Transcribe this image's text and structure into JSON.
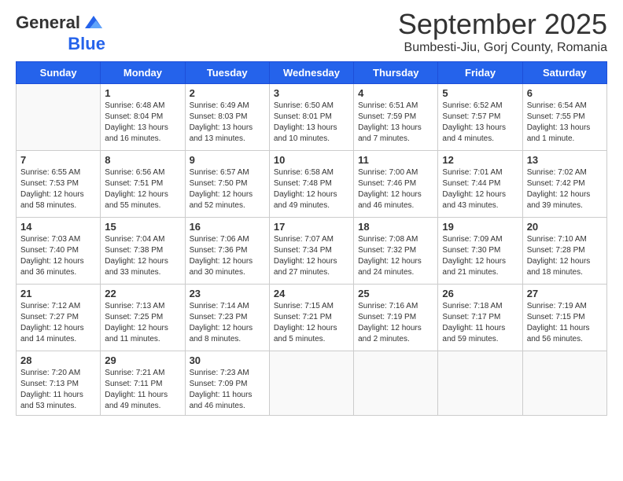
{
  "header": {
    "logo_general": "General",
    "logo_blue": "Blue",
    "month_title": "September 2025",
    "subtitle": "Bumbesti-Jiu, Gorj County, Romania"
  },
  "days_of_week": [
    "Sunday",
    "Monday",
    "Tuesday",
    "Wednesday",
    "Thursday",
    "Friday",
    "Saturday"
  ],
  "weeks": [
    [
      {
        "day": "",
        "info": ""
      },
      {
        "day": "1",
        "info": "Sunrise: 6:48 AM\nSunset: 8:04 PM\nDaylight: 13 hours\nand 16 minutes."
      },
      {
        "day": "2",
        "info": "Sunrise: 6:49 AM\nSunset: 8:03 PM\nDaylight: 13 hours\nand 13 minutes."
      },
      {
        "day": "3",
        "info": "Sunrise: 6:50 AM\nSunset: 8:01 PM\nDaylight: 13 hours\nand 10 minutes."
      },
      {
        "day": "4",
        "info": "Sunrise: 6:51 AM\nSunset: 7:59 PM\nDaylight: 13 hours\nand 7 minutes."
      },
      {
        "day": "5",
        "info": "Sunrise: 6:52 AM\nSunset: 7:57 PM\nDaylight: 13 hours\nand 4 minutes."
      },
      {
        "day": "6",
        "info": "Sunrise: 6:54 AM\nSunset: 7:55 PM\nDaylight: 13 hours\nand 1 minute."
      }
    ],
    [
      {
        "day": "7",
        "info": "Sunrise: 6:55 AM\nSunset: 7:53 PM\nDaylight: 12 hours\nand 58 minutes."
      },
      {
        "day": "8",
        "info": "Sunrise: 6:56 AM\nSunset: 7:51 PM\nDaylight: 12 hours\nand 55 minutes."
      },
      {
        "day": "9",
        "info": "Sunrise: 6:57 AM\nSunset: 7:50 PM\nDaylight: 12 hours\nand 52 minutes."
      },
      {
        "day": "10",
        "info": "Sunrise: 6:58 AM\nSunset: 7:48 PM\nDaylight: 12 hours\nand 49 minutes."
      },
      {
        "day": "11",
        "info": "Sunrise: 7:00 AM\nSunset: 7:46 PM\nDaylight: 12 hours\nand 46 minutes."
      },
      {
        "day": "12",
        "info": "Sunrise: 7:01 AM\nSunset: 7:44 PM\nDaylight: 12 hours\nand 43 minutes."
      },
      {
        "day": "13",
        "info": "Sunrise: 7:02 AM\nSunset: 7:42 PM\nDaylight: 12 hours\nand 39 minutes."
      }
    ],
    [
      {
        "day": "14",
        "info": "Sunrise: 7:03 AM\nSunset: 7:40 PM\nDaylight: 12 hours\nand 36 minutes."
      },
      {
        "day": "15",
        "info": "Sunrise: 7:04 AM\nSunset: 7:38 PM\nDaylight: 12 hours\nand 33 minutes."
      },
      {
        "day": "16",
        "info": "Sunrise: 7:06 AM\nSunset: 7:36 PM\nDaylight: 12 hours\nand 30 minutes."
      },
      {
        "day": "17",
        "info": "Sunrise: 7:07 AM\nSunset: 7:34 PM\nDaylight: 12 hours\nand 27 minutes."
      },
      {
        "day": "18",
        "info": "Sunrise: 7:08 AM\nSunset: 7:32 PM\nDaylight: 12 hours\nand 24 minutes."
      },
      {
        "day": "19",
        "info": "Sunrise: 7:09 AM\nSunset: 7:30 PM\nDaylight: 12 hours\nand 21 minutes."
      },
      {
        "day": "20",
        "info": "Sunrise: 7:10 AM\nSunset: 7:28 PM\nDaylight: 12 hours\nand 18 minutes."
      }
    ],
    [
      {
        "day": "21",
        "info": "Sunrise: 7:12 AM\nSunset: 7:27 PM\nDaylight: 12 hours\nand 14 minutes."
      },
      {
        "day": "22",
        "info": "Sunrise: 7:13 AM\nSunset: 7:25 PM\nDaylight: 12 hours\nand 11 minutes."
      },
      {
        "day": "23",
        "info": "Sunrise: 7:14 AM\nSunset: 7:23 PM\nDaylight: 12 hours\nand 8 minutes."
      },
      {
        "day": "24",
        "info": "Sunrise: 7:15 AM\nSunset: 7:21 PM\nDaylight: 12 hours\nand 5 minutes."
      },
      {
        "day": "25",
        "info": "Sunrise: 7:16 AM\nSunset: 7:19 PM\nDaylight: 12 hours\nand 2 minutes."
      },
      {
        "day": "26",
        "info": "Sunrise: 7:18 AM\nSunset: 7:17 PM\nDaylight: 11 hours\nand 59 minutes."
      },
      {
        "day": "27",
        "info": "Sunrise: 7:19 AM\nSunset: 7:15 PM\nDaylight: 11 hours\nand 56 minutes."
      }
    ],
    [
      {
        "day": "28",
        "info": "Sunrise: 7:20 AM\nSunset: 7:13 PM\nDaylight: 11 hours\nand 53 minutes."
      },
      {
        "day": "29",
        "info": "Sunrise: 7:21 AM\nSunset: 7:11 PM\nDaylight: 11 hours\nand 49 minutes."
      },
      {
        "day": "30",
        "info": "Sunrise: 7:23 AM\nSunset: 7:09 PM\nDaylight: 11 hours\nand 46 minutes."
      },
      {
        "day": "",
        "info": ""
      },
      {
        "day": "",
        "info": ""
      },
      {
        "day": "",
        "info": ""
      },
      {
        "day": "",
        "info": ""
      }
    ]
  ]
}
